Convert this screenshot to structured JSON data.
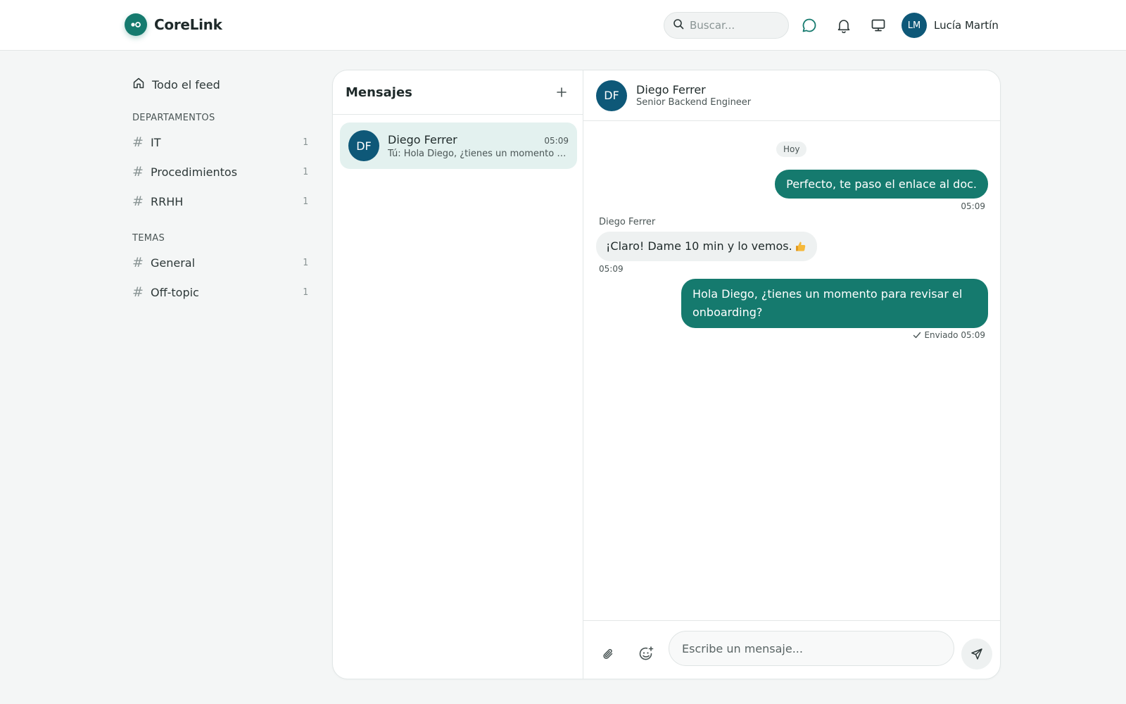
{
  "header": {
    "brand": "CoreLink",
    "search_placeholder": "Buscar...",
    "user_initials": "LM",
    "user_name": "Lucía Martín"
  },
  "sidebar": {
    "feed_label": "Todo el feed",
    "departments_title": "DEPARTAMENTOS",
    "departments": [
      {
        "label": "IT",
        "count": "1"
      },
      {
        "label": "Procedimientos",
        "count": "1"
      },
      {
        "label": "RRHH",
        "count": "1"
      }
    ],
    "topics_title": "TEMAS",
    "topics": [
      {
        "label": "General",
        "count": "1"
      },
      {
        "label": "Off-topic",
        "count": "1"
      }
    ]
  },
  "messages_panel": {
    "title": "Mensajes",
    "conversations": [
      {
        "initials": "DF",
        "name": "Diego Ferrer",
        "time": "05:09",
        "preview": "Tú: Hola Diego, ¿tienes un momento para revisar el onboarding?"
      }
    ]
  },
  "chat": {
    "contact_initials": "DF",
    "contact_name": "Diego Ferrer",
    "contact_role": "Senior Backend Engineer",
    "day_label": "Hoy",
    "messages": [
      {
        "direction": "out",
        "text": "Perfecto, te paso el enlace al doc.",
        "time": "05:09"
      },
      {
        "direction": "in",
        "sender": "Diego Ferrer",
        "text": "¡Claro! Dame 10 min y lo vemos.",
        "time": "05:09"
      },
      {
        "direction": "out",
        "text": "Hola Diego, ¿tienes un momento para revisar el onboarding?",
        "time": "05:09",
        "status": "Enviado"
      }
    ],
    "input_placeholder": "Escribe un mensaje..."
  },
  "colors": {
    "accent": "#157a6e",
    "avatar": "#0e5878",
    "selected_conversation": "#e3f1ef"
  }
}
